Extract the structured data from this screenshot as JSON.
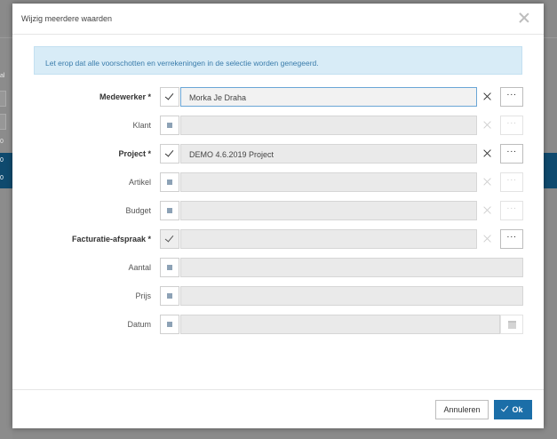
{
  "dialog": {
    "title": "Wijzig meerdere waarden",
    "info": "Let erop dat alle voorschotten en verrekeningen in de selectie worden genegeerd."
  },
  "background": {
    "labels": [
      "al",
      "0",
      "0",
      "0"
    ]
  },
  "fields": [
    {
      "label": "Medewerker *",
      "required": true,
      "checked": true,
      "value": "Morka Je Draha",
      "clear_enabled": true,
      "more_enabled": true
    },
    {
      "label": "Klant",
      "required": false,
      "checked": false,
      "value": "",
      "clear_enabled": false,
      "more_enabled": false
    },
    {
      "label": "Project *",
      "required": true,
      "checked": true,
      "value": "DEMO 4.6.2019 Project",
      "clear_enabled": true,
      "more_enabled": true
    },
    {
      "label": "Artikel",
      "required": false,
      "checked": false,
      "value": "",
      "clear_enabled": false,
      "more_enabled": false
    },
    {
      "label": "Budget",
      "required": false,
      "checked": false,
      "value": "",
      "clear_enabled": false,
      "more_enabled": false
    },
    {
      "label": "Facturatie-afspraak *",
      "required": true,
      "checked": true,
      "value": "",
      "clear_enabled": false,
      "more_enabled": true
    },
    {
      "label": "Aantal",
      "required": false,
      "checked": false,
      "value": ""
    },
    {
      "label": "Prijs",
      "required": false,
      "checked": false,
      "value": ""
    },
    {
      "label": "Datum",
      "required": false,
      "checked": false,
      "value": ""
    }
  ],
  "buttons": {
    "cancel": "Annuleren",
    "ok": "Ok"
  },
  "colors": {
    "accent": "#1b6ea8",
    "info_bg": "#d8ecf7",
    "info_text": "#3a7cab"
  },
  "icons": {
    "close": "close-icon",
    "clear": "clear-x-icon",
    "more": "ellipsis-icon",
    "calendar": "calendar-icon",
    "check": "checkmark-icon"
  }
}
